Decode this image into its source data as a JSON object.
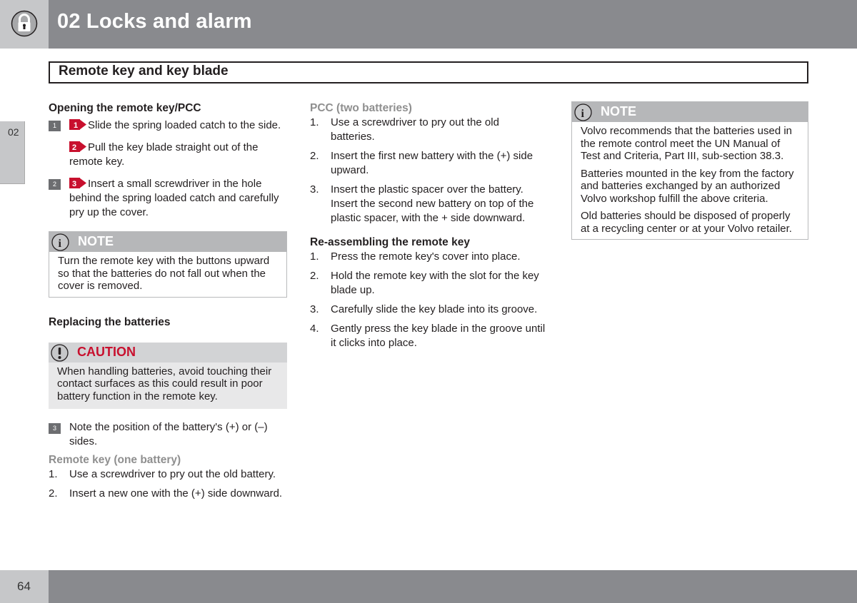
{
  "header": {
    "chapter_title": "02 Locks and alarm",
    "section_title": "Remote key and key blade",
    "side_tab": "02"
  },
  "footer": {
    "page_number": "64"
  },
  "colors": {
    "header_dark": "#898a8e",
    "header_light": "#c6c7c9",
    "accent_red": "#c8102e",
    "step_badge": "#6d6e71"
  },
  "col1": {
    "heading_opening": "Opening the remote key/PCC",
    "steps": [
      {
        "badge": "1",
        "paras": [
          {
            "arrow": "1",
            "text": "Slide the spring loaded catch to the side."
          },
          {
            "arrow": "2",
            "text": "Pull the key blade straight out of the remote key."
          }
        ]
      },
      {
        "badge": "2",
        "paras": [
          {
            "arrow": "3",
            "text": "Insert a small screwdriver in the hole behind the spring loaded catch and carefully pry up the cover."
          }
        ]
      }
    ],
    "note": {
      "label": "NOTE",
      "icon": "info-icon",
      "text": "Turn the remote key with the buttons upward so that the batteries do not fall out when the cover is removed."
    },
    "heading_replacing": "Replacing the batteries",
    "caution": {
      "label": "CAUTION",
      "icon": "exclamation-icon",
      "text": "When handling batteries, avoid touching their contact surfaces as this could result in poor battery function in the remote key."
    },
    "step3": {
      "badge": "3",
      "text": "Note the position of the battery's (+) or (–) sides."
    },
    "remote_heading": "Remote key (one battery)",
    "remote_list": [
      {
        "n": "1.",
        "text": "Use a screwdriver to pry out the old battery."
      },
      {
        "n": "2.",
        "text": "Insert a new one with the (+) side downward."
      }
    ]
  },
  "col2": {
    "pcc_heading": "PCC (two batteries)",
    "pcc_list": [
      {
        "n": "1.",
        "text": "Use a screwdriver to pry out the old batteries."
      },
      {
        "n": "2.",
        "text": "Insert the first new battery with the (+) side upward."
      },
      {
        "n": "3.",
        "text": "Insert the plastic spacer over the battery. Insert the second new battery on top of the plastic spacer, with the + side downward."
      }
    ],
    "reassembly_heading": "Re-assembling the remote key",
    "reassembly_list": [
      {
        "n": "1.",
        "text": "Press the remote key's cover into place."
      },
      {
        "n": "2.",
        "text": "Hold the remote key with the slot for the key blade up."
      },
      {
        "n": "3.",
        "text": "Carefully slide the key blade into its groove."
      },
      {
        "n": "4.",
        "text": "Gently press the key blade in the groove until it clicks into place."
      }
    ]
  },
  "col3": {
    "note": {
      "label": "NOTE",
      "icon": "info-icon",
      "paras": [
        "Volvo recommends that the batteries used in the remote control meet the UN Manual of Test and Criteria, Part III, sub-section 38.3.",
        "Batteries mounted in the key from the factory and batteries exchanged by an authorized Volvo workshop fulfill the above criteria.",
        "Old batteries should be disposed of properly at a recycling center or at your Volvo retailer."
      ]
    }
  }
}
